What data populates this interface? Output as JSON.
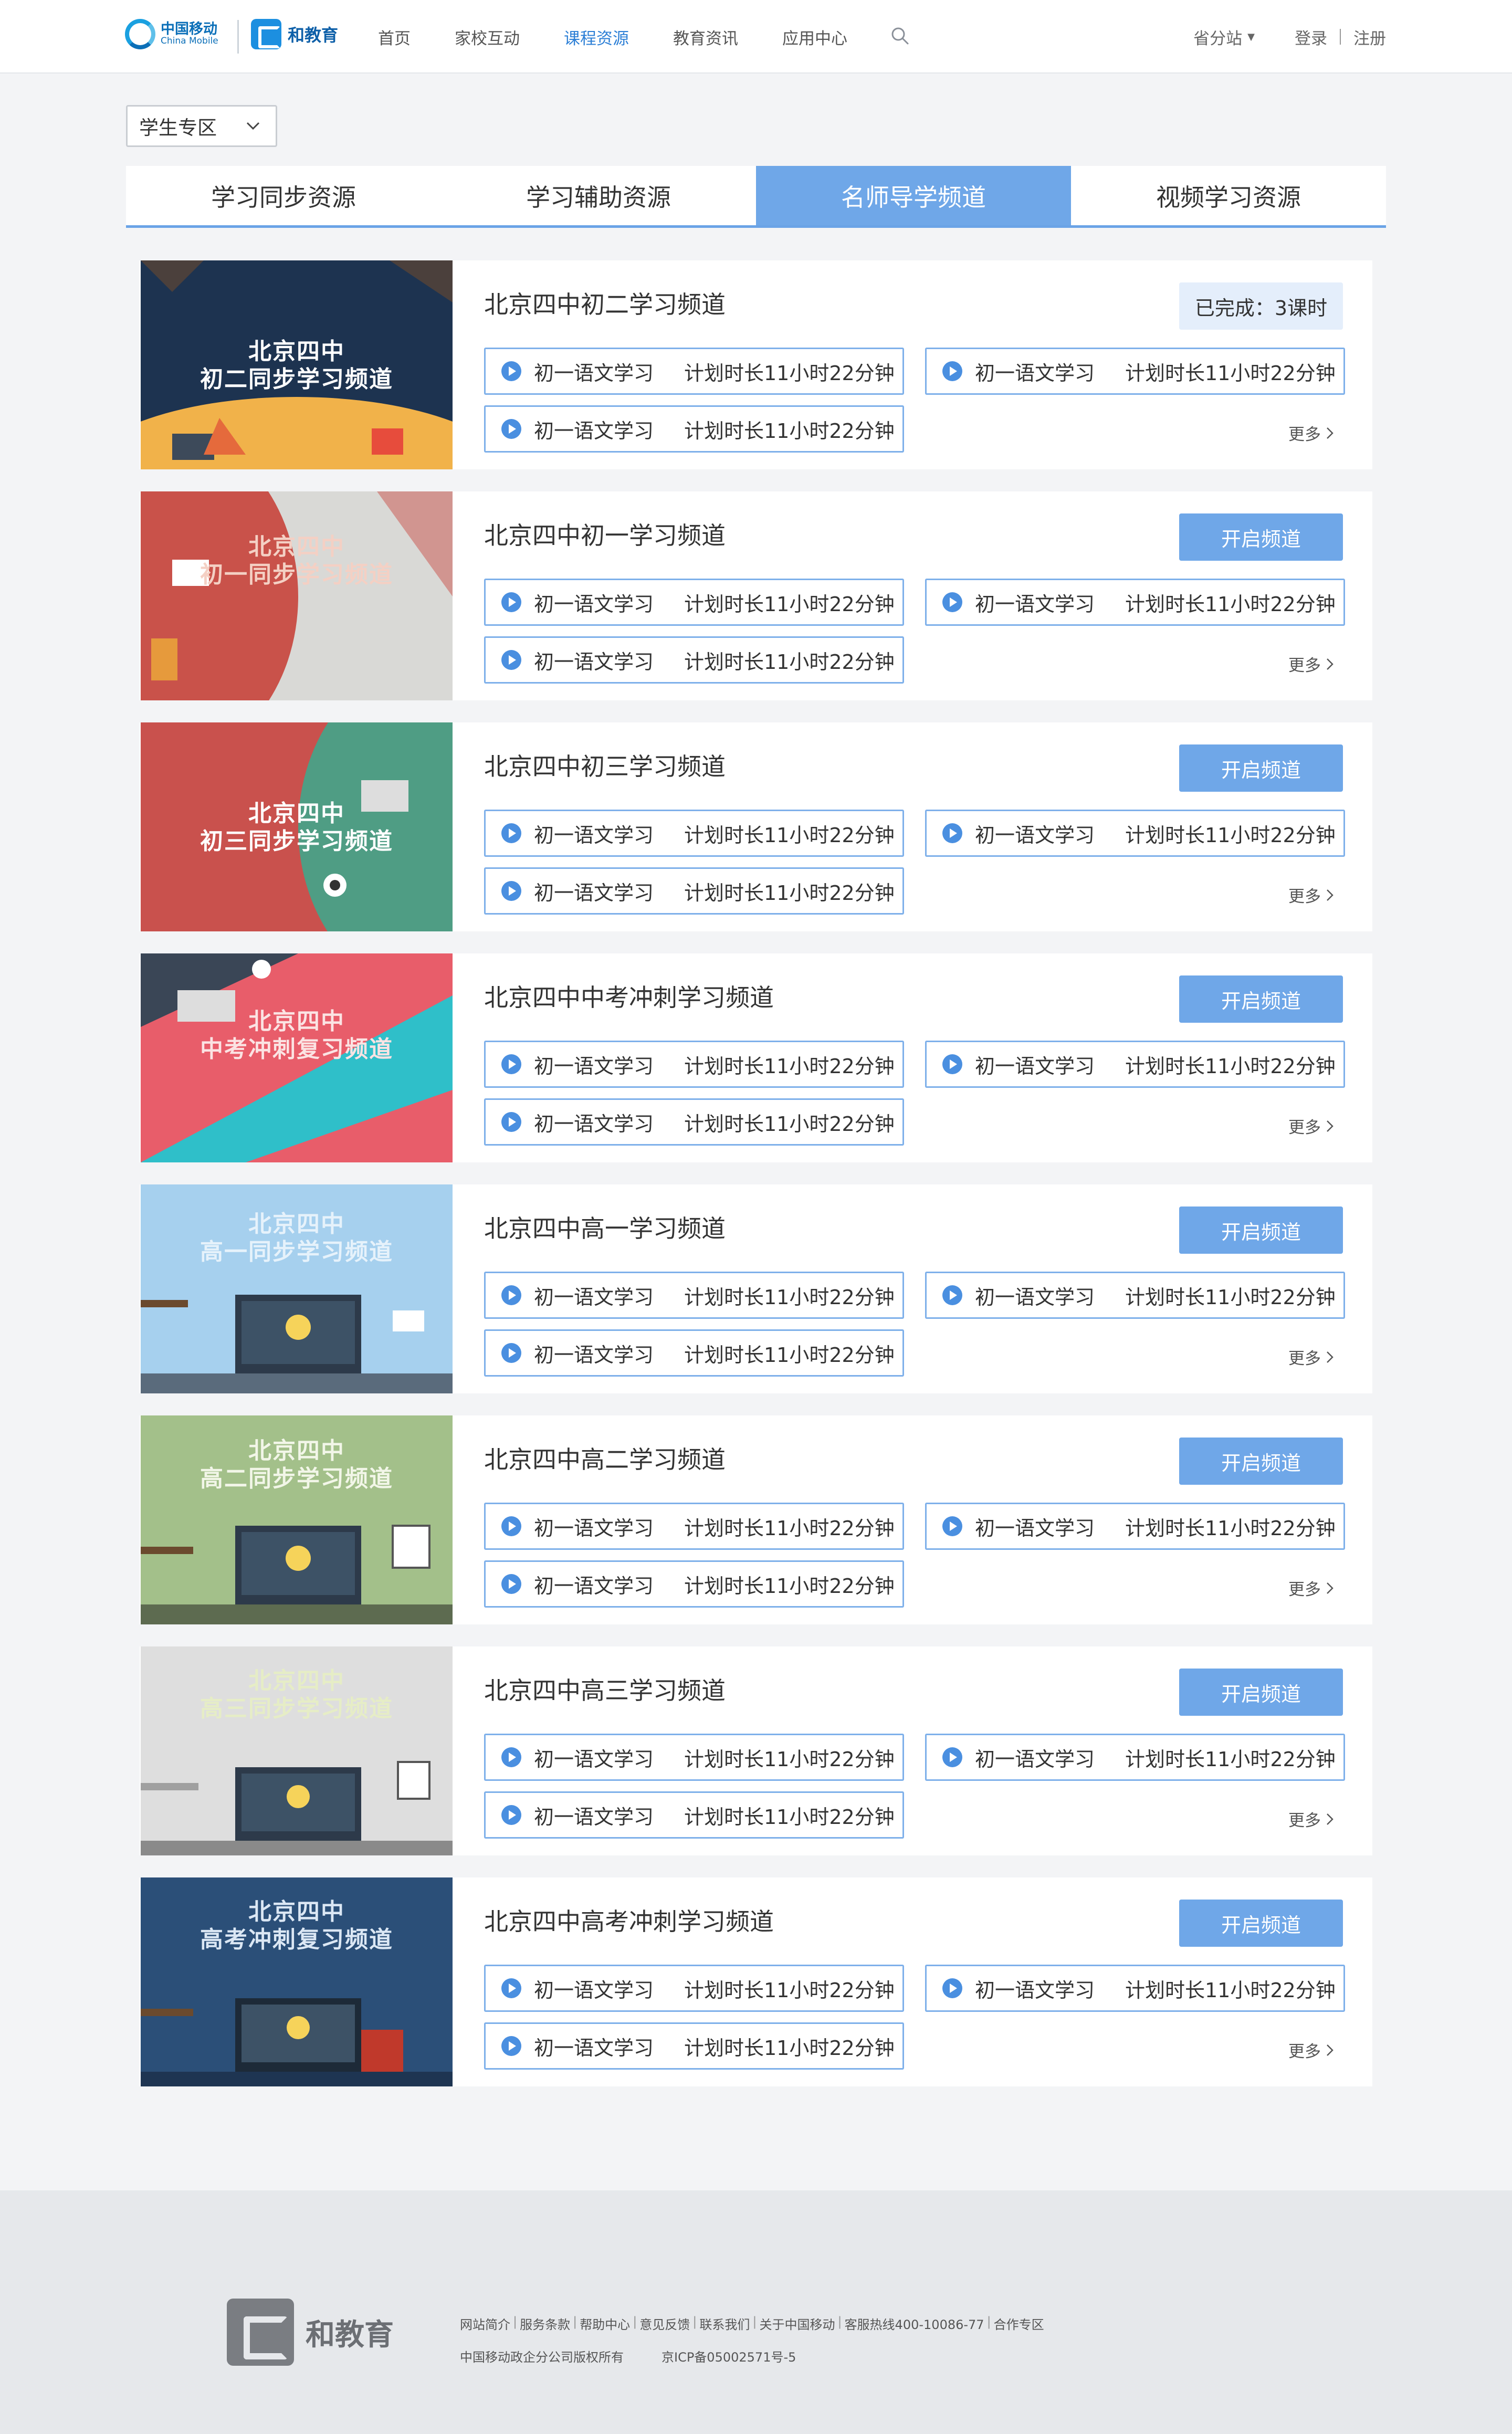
{
  "header": {
    "logo_cn": "中国移动",
    "logo_en": "China Mobile",
    "brand": "和教育",
    "nav": [
      {
        "label": "首页",
        "active": false
      },
      {
        "label": "家校互动",
        "active": false
      },
      {
        "label": "课程资源",
        "active": true
      },
      {
        "label": "教育资讯",
        "active": false
      },
      {
        "label": "应用中心",
        "active": false
      }
    ],
    "province": "省分站",
    "login": "登录",
    "register": "注册"
  },
  "zone_select": {
    "value": "学生专区"
  },
  "tabs": [
    {
      "label": "学习同步资源",
      "active": false
    },
    {
      "label": "学习辅助资源",
      "active": false
    },
    {
      "label": "名师导学频道",
      "active": true
    },
    {
      "label": "视频学习资源",
      "active": false
    }
  ],
  "channels": [
    {
      "thumb_title": [
        "北京四中",
        "初二同步学习频道"
      ],
      "title": "北京四中初二学习频道",
      "button": "已完成：3课时",
      "button_kind": "done",
      "lessons": [
        {
          "name": "初一语文学习",
          "time": "计划时长11小时22分钟"
        },
        {
          "name": "初一语文学习",
          "time": "计划时长11小时22分钟"
        },
        {
          "name": "初一语文学习",
          "time": "计划时长11小时22分钟"
        }
      ],
      "more": "更多"
    },
    {
      "thumb_title": [
        "北京四中",
        "初一同步学习频道"
      ],
      "title": "北京四中初一学习频道",
      "button": "开启频道",
      "button_kind": "open",
      "lessons": [
        {
          "name": "初一语文学习",
          "time": "计划时长11小时22分钟"
        },
        {
          "name": "初一语文学习",
          "time": "计划时长11小时22分钟"
        },
        {
          "name": "初一语文学习",
          "time": "计划时长11小时22分钟"
        }
      ],
      "more": "更多"
    },
    {
      "thumb_title": [
        "北京四中",
        "初三同步学习频道"
      ],
      "title": "北京四中初三学习频道",
      "button": "开启频道",
      "button_kind": "open",
      "lessons": [
        {
          "name": "初一语文学习",
          "time": "计划时长11小时22分钟"
        },
        {
          "name": "初一语文学习",
          "time": "计划时长11小时22分钟"
        },
        {
          "name": "初一语文学习",
          "time": "计划时长11小时22分钟"
        }
      ],
      "more": "更多"
    },
    {
      "thumb_title": [
        "北京四中",
        "中考冲刺复习频道"
      ],
      "title": "北京四中中考冲刺学习频道",
      "button": "开启频道",
      "button_kind": "open",
      "lessons": [
        {
          "name": "初一语文学习",
          "time": "计划时长11小时22分钟"
        },
        {
          "name": "初一语文学习",
          "time": "计划时长11小时22分钟"
        },
        {
          "name": "初一语文学习",
          "time": "计划时长11小时22分钟"
        }
      ],
      "more": "更多"
    },
    {
      "thumb_title": [
        "北京四中",
        "高一同步学习频道"
      ],
      "title": "北京四中高一学习频道",
      "button": "开启频道",
      "button_kind": "open",
      "lessons": [
        {
          "name": "初一语文学习",
          "time": "计划时长11小时22分钟"
        },
        {
          "name": "初一语文学习",
          "time": "计划时长11小时22分钟"
        },
        {
          "name": "初一语文学习",
          "time": "计划时长11小时22分钟"
        }
      ],
      "more": "更多"
    },
    {
      "thumb_title": [
        "北京四中",
        "高二同步学习频道"
      ],
      "title": "北京四中高二学习频道",
      "button": "开启频道",
      "button_kind": "open",
      "lessons": [
        {
          "name": "初一语文学习",
          "time": "计划时长11小时22分钟"
        },
        {
          "name": "初一语文学习",
          "time": "计划时长11小时22分钟"
        },
        {
          "name": "初一语文学习",
          "time": "计划时长11小时22分钟"
        }
      ],
      "more": "更多"
    },
    {
      "thumb_title": [
        "北京四中",
        "高三同步学习频道"
      ],
      "title": "北京四中高三学习频道",
      "button": "开启频道",
      "button_kind": "open",
      "lessons": [
        {
          "name": "初一语文学习",
          "time": "计划时长11小时22分钟"
        },
        {
          "name": "初一语文学习",
          "time": "计划时长11小时22分钟"
        },
        {
          "name": "初一语文学习",
          "time": "计划时长11小时22分钟"
        }
      ],
      "more": "更多"
    },
    {
      "thumb_title": [
        "北京四中",
        "高考冲刺复习频道"
      ],
      "title": "北京四中高考冲刺学习频道",
      "button": "开启频道",
      "button_kind": "open",
      "lessons": [
        {
          "name": "初一语文学习",
          "time": "计划时长11小时22分钟"
        },
        {
          "name": "初一语文学习",
          "time": "计划时长11小时22分钟"
        },
        {
          "name": "初一语文学习",
          "time": "计划时长11小时22分钟"
        }
      ],
      "more": "更多"
    }
  ],
  "footer": {
    "brand": "和教育",
    "links": [
      "网站简介",
      "服务条款",
      "帮助中心",
      "意见反馈",
      "联系我们",
      "关于中国移动",
      "客服热线400-10086-77",
      "合作专区"
    ],
    "copyright": "中国移动政企分公司版权所有",
    "icp": "京ICP备05002571号-5"
  },
  "colors": {
    "accent": "#6fa7e8",
    "nav_active": "#2c7fd6",
    "page_bg": "#f3f4f6",
    "footer_bg": "#e6e8eb"
  }
}
